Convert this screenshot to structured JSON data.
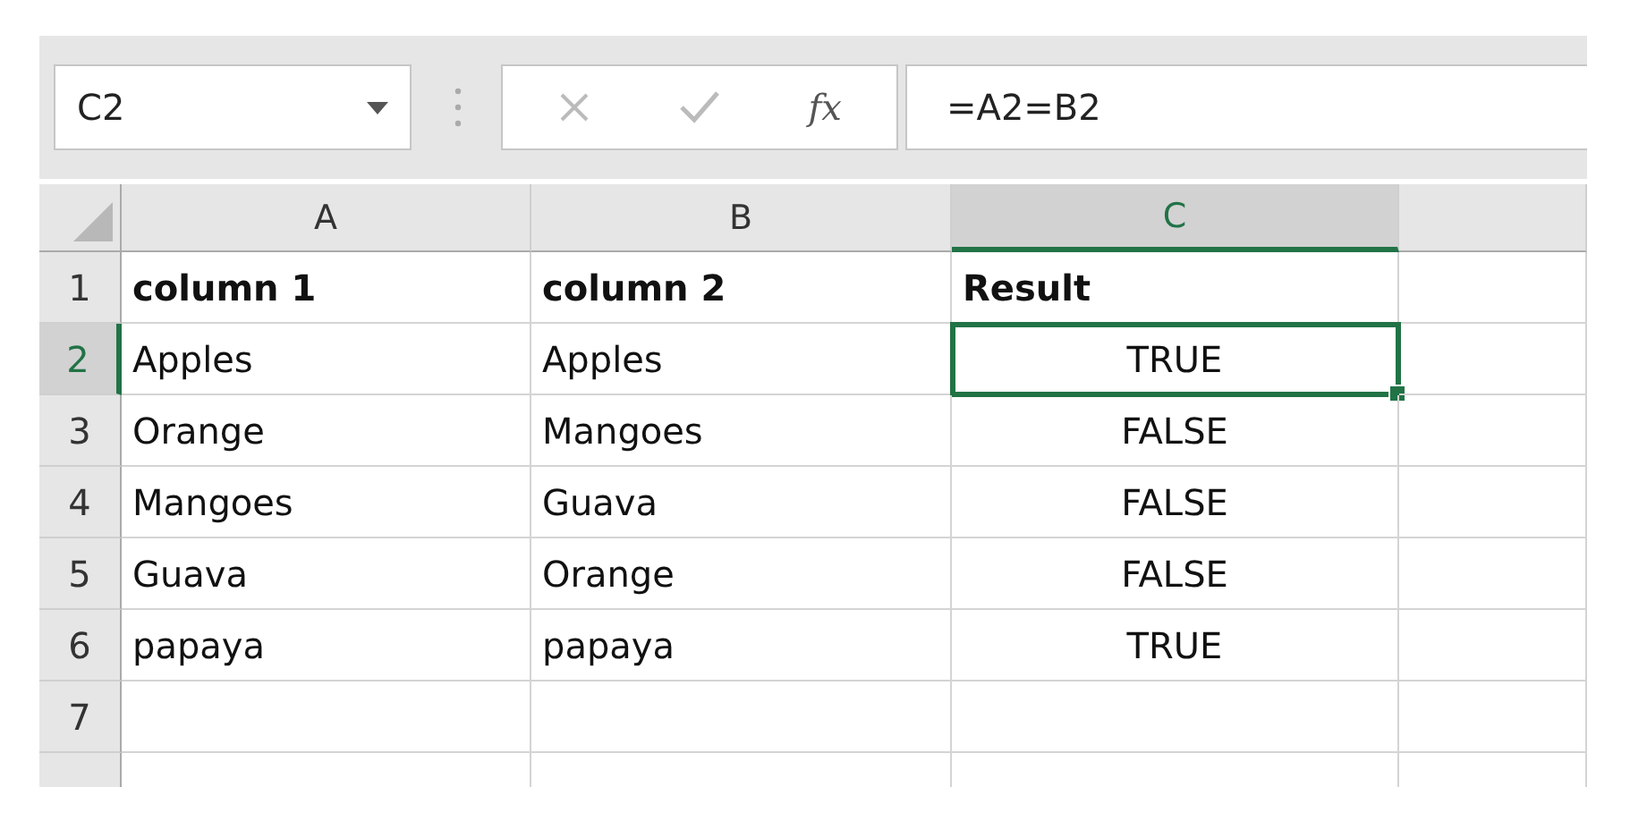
{
  "name_box": {
    "value": "C2"
  },
  "formula_bar": {
    "function_label": "fx",
    "formula": "=A2=B2"
  },
  "columns": [
    {
      "label": "A",
      "selected": false
    },
    {
      "label": "B",
      "selected": false
    },
    {
      "label": "C",
      "selected": true
    }
  ],
  "rows": [
    {
      "header": "1",
      "selected": false,
      "cells": [
        {
          "text": "column 1",
          "kind": "text",
          "bold": true,
          "selected": false
        },
        {
          "text": "column 2",
          "kind": "text",
          "bold": true,
          "selected": false
        },
        {
          "text": "Result",
          "kind": "text",
          "bold": true,
          "selected": false
        }
      ]
    },
    {
      "header": "2",
      "selected": true,
      "cells": [
        {
          "text": "Apples",
          "kind": "text",
          "bold": false,
          "selected": false
        },
        {
          "text": "Apples",
          "kind": "text",
          "bold": false,
          "selected": false
        },
        {
          "text": "TRUE",
          "kind": "boolean",
          "bold": false,
          "selected": true
        }
      ]
    },
    {
      "header": "3",
      "selected": false,
      "cells": [
        {
          "text": "Orange",
          "kind": "text",
          "bold": false,
          "selected": false
        },
        {
          "text": "Mangoes",
          "kind": "text",
          "bold": false,
          "selected": false
        },
        {
          "text": "FALSE",
          "kind": "boolean",
          "bold": false,
          "selected": false
        }
      ]
    },
    {
      "header": "4",
      "selected": false,
      "cells": [
        {
          "text": "Mangoes",
          "kind": "text",
          "bold": false,
          "selected": false
        },
        {
          "text": "Guava",
          "kind": "text",
          "bold": false,
          "selected": false
        },
        {
          "text": "FALSE",
          "kind": "boolean",
          "bold": false,
          "selected": false
        }
      ]
    },
    {
      "header": "5",
      "selected": false,
      "cells": [
        {
          "text": "Guava",
          "kind": "text",
          "bold": false,
          "selected": false
        },
        {
          "text": "Orange",
          "kind": "text",
          "bold": false,
          "selected": false
        },
        {
          "text": "FALSE",
          "kind": "boolean",
          "bold": false,
          "selected": false
        }
      ]
    },
    {
      "header": "6",
      "selected": false,
      "cells": [
        {
          "text": "papaya",
          "kind": "text",
          "bold": false,
          "selected": false
        },
        {
          "text": "papaya",
          "kind": "text",
          "bold": false,
          "selected": false
        },
        {
          "text": "TRUE",
          "kind": "boolean",
          "bold": false,
          "selected": false
        }
      ]
    },
    {
      "header": "7",
      "selected": false
    }
  ]
}
